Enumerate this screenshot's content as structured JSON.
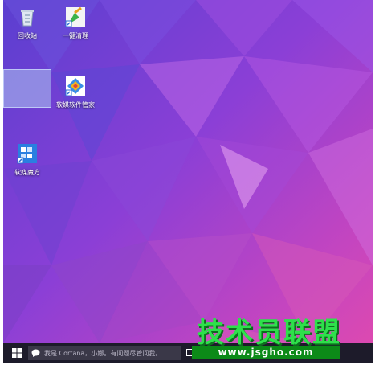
{
  "desktop": {
    "icons": [
      {
        "label": "回收站",
        "icon": "recycle-bin-icon"
      },
      {
        "label": "一键清理",
        "icon": "broom-cleanup-icon"
      },
      {
        "label": "软媒软件管家",
        "icon": "software-manager-icon"
      },
      {
        "label": "软媒魔方",
        "icon": "rubik-cube-icon"
      }
    ]
  },
  "taskbar": {
    "start_icon": "windows-logo-icon",
    "search_placeholder": "我是 Cortana，小娜。有问题尽管问我。",
    "task_view_icon": "task-view-icon"
  },
  "watermark": {
    "title": "技术员联盟",
    "url": "www.jsgho.com"
  },
  "colors": {
    "wallpaper_dark": "#5a3fd0",
    "wallpaper_mid": "#9a3fd8",
    "wallpaper_pink": "#e04aae",
    "taskbar": "#1d1b2a",
    "watermark_green": "#2ee04b"
  }
}
